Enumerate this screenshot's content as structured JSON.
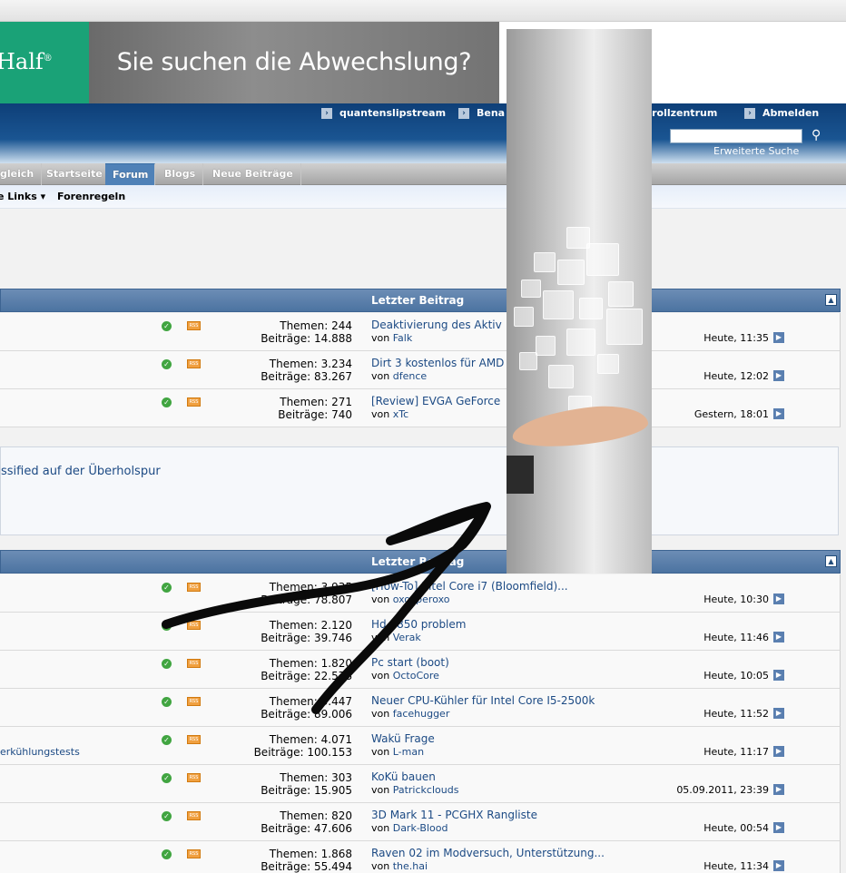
{
  "banner": {
    "logo_text": "Half",
    "logo_mark": "®",
    "ad_text": "Sie suchen die Abwechslung?"
  },
  "user_links": [
    {
      "label": "quantenslipstream"
    },
    {
      "label": "Bena"
    },
    {
      "label": "ntrollzentrum"
    },
    {
      "label": "Abmelden"
    }
  ],
  "search": {
    "value": "",
    "advanced_label": "Erweiterte Suche"
  },
  "nav": {
    "tabs": [
      {
        "label": "gleich"
      },
      {
        "label": "Startseite"
      },
      {
        "label": "Forum",
        "active": true
      },
      {
        "label": "Blogs"
      },
      {
        "label": "Neue Beiträge"
      }
    ],
    "sub": [
      {
        "label": "e Links"
      },
      {
        "label": "Forenregeln"
      }
    ]
  },
  "category1": {
    "header_label": "Letzter Beitrag",
    "collapse_icon": "collapse-icon",
    "rows": [
      {
        "themen": "Themen: 244",
        "beitraege": "Beiträge: 14.888",
        "title": "Deaktivierung des Aktiv",
        "by_prefix": "von",
        "by_user": "Falk",
        "time": "Heute, 11:35"
      },
      {
        "themen": "Themen: 3.234",
        "beitraege": "Beiträge: 83.267",
        "title": "Dirt 3 kostenlos für AMD",
        "by_prefix": "von",
        "by_user": "dfence",
        "time": "Heute, 12:02"
      },
      {
        "themen": "Themen: 271",
        "beitraege": "Beiträge: 740",
        "title": "[Review] EVGA GeForce",
        "by_prefix": "von",
        "by_user": "xTc",
        "time": "Gestern, 18:01"
      }
    ]
  },
  "info_box": {
    "text": "ssified auf der Überholspur"
  },
  "category2": {
    "header_label": "Letzter Be trag",
    "rows": [
      {
        "themen": "Themen: 3.935",
        "beitraege": "Beiträge: 78.807",
        "title": "[How-To] Intel Core i7 (Bloomfield)...",
        "by_prefix": "von",
        "by_user": "oxoxperoxo",
        "time": "Heute, 10:30",
        "desc": ""
      },
      {
        "themen": "Themen: 2.120",
        "beitraege": "Beiträge: 39.746",
        "title": "Hd 6850 problem",
        "by_prefix": "von",
        "by_user": "Verak",
        "time": "Heute, 11:46",
        "desc": ""
      },
      {
        "themen": "Themen: 1.820",
        "beitraege": "Beiträge: 22.578",
        "title": "Pc start (boot)",
        "by_prefix": "von",
        "by_user": "OctoCore",
        "time": "Heute, 10:05",
        "desc": ""
      },
      {
        "themen": "Themen: 3.447",
        "beitraege": "Beiträge: 89.006",
        "title": "Neuer CPU-Kühler für Intel Core I5-2500k",
        "by_prefix": "von",
        "by_user": "facehugger",
        "time": "Heute, 11:52",
        "desc": ""
      },
      {
        "themen": "Themen: 4.071",
        "beitraege": "Beiträge: 100.153",
        "title": "Wakü Frage",
        "by_prefix": "von",
        "by_user": "L-man",
        "time": "Heute, 11:17",
        "desc": "erkühlungstests"
      },
      {
        "themen": "Themen: 303",
        "beitraege": "Beiträge: 15.905",
        "title": "KoKü bauen",
        "by_prefix": "von",
        "by_user": "Patrickclouds",
        "time": "05.09.2011, 23:39",
        "desc": ""
      },
      {
        "themen": "Themen: 820",
        "beitraege": "Beiträge: 47.606",
        "title": "3D Mark 11 - PCGHX Rangliste",
        "by_prefix": "von",
        "by_user": "Dark-Blood",
        "time": "Heute, 00:54",
        "desc": ""
      },
      {
        "themen": "Themen: 1.868",
        "beitraege": "Beiträge: 55.494",
        "title": "Raven 02 im Modversuch, Unterstützung...",
        "by_prefix": "von",
        "by_user": "the.hai",
        "time": "Heute, 11:34",
        "desc": ""
      }
    ]
  },
  "icons": {
    "status": "checkmark-icon",
    "rss": "rss-icon",
    "goto": "goto-last-post-icon",
    "search": "search-icon"
  },
  "colors": {
    "header_blue": "#0e3f78",
    "category_blue": "#4c73a1",
    "link_blue": "#1c4a84",
    "logo_green": "#1aa277"
  }
}
